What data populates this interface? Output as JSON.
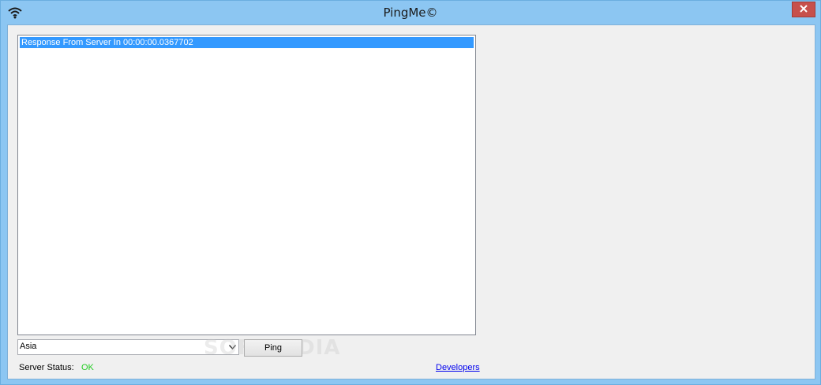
{
  "window": {
    "title": "PingMe©"
  },
  "listbox": {
    "items": [
      "Response From Server In 00:00:00.0367702"
    ]
  },
  "server_select": {
    "value": "Asia"
  },
  "ping_button": {
    "label": "Ping"
  },
  "status": {
    "label": "Server Status:",
    "value": "OK",
    "value_color": "#22cc22"
  },
  "developers_link": {
    "label": "Developers"
  },
  "watermark": {
    "text": "SOFTPEDIA"
  }
}
